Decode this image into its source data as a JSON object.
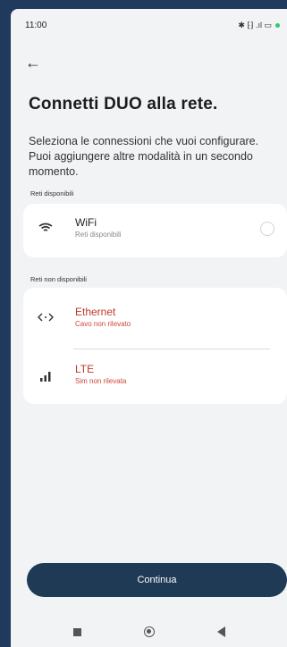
{
  "status_bar": {
    "time": "11:00",
    "icons": "✱ ⁅⁆ .ıl ▭",
    "icon_names": [
      "bluetooth-icon",
      "signal-icon",
      "battery-icon"
    ]
  },
  "header": {
    "back_icon": "←",
    "title": "Connetti DUO alla rete.",
    "subtitle": "Seleziona le connessioni che vuoi configurare. Puoi aggiungere altre modalità in un secondo momento."
  },
  "available": {
    "section_label": "Reti disponibili",
    "items": [
      {
        "icon": "wifi-icon",
        "icon_glyph": "≋",
        "title": "WiFi",
        "subtitle": "Reti disponibili",
        "selected": false
      }
    ]
  },
  "unavailable": {
    "section_label": "Reti non disponibili",
    "items": [
      {
        "icon": "ethernet-icon",
        "icon_glyph": "⟨·⟩",
        "title": "Ethernet",
        "subtitle": "Cavo non rilevato"
      },
      {
        "icon": "signal-bars-icon",
        "icon_glyph": ".ıl",
        "title": "LTE",
        "subtitle": "Sim non rilevata"
      }
    ]
  },
  "actions": {
    "continue_label": "Continua"
  },
  "colors": {
    "primary": "#1e3a55",
    "error": "#c0392b",
    "background": "#f2f3f5"
  }
}
